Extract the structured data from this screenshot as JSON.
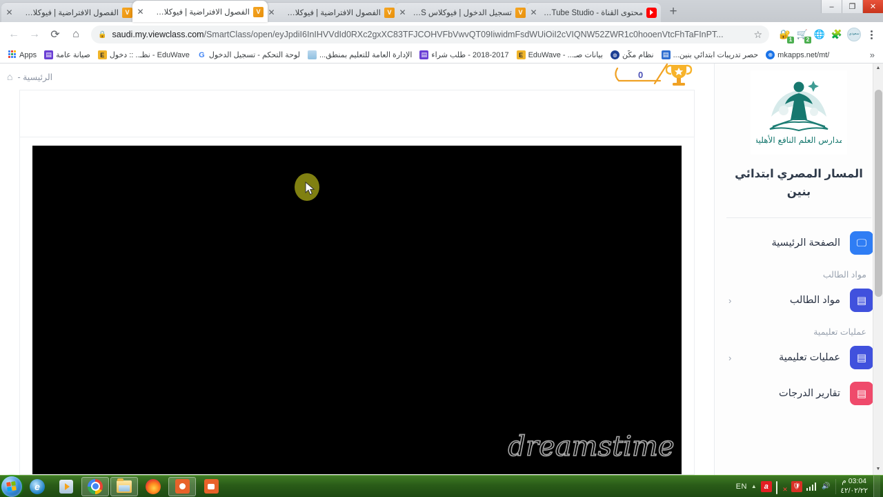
{
  "browser": {
    "tabs": [
      {
        "title": "الفصول الافتراضية | فيوكلاس LMS",
        "favicon": "viewclass-icon",
        "active": false
      },
      {
        "title": "الفصول الافتراضية | فيوكلاس LMS",
        "favicon": "viewclass-icon",
        "active": true
      },
      {
        "title": "الفصول الافتراضية | فيوكلاس LMS",
        "favicon": "viewclass-icon",
        "active": false
      },
      {
        "title": "تسجيل الدخول | فيوكلاس LMS",
        "favicon": "viewclass-icon",
        "active": false
      },
      {
        "title": "محتوى القناة - YouTube Studio",
        "favicon": "youtube-icon",
        "active": false
      }
    ],
    "new_tab_label": "+",
    "window_controls": {
      "minimize": "–",
      "maximize": "❐",
      "close": "✕"
    },
    "nav": {
      "back": "←",
      "forward": "→",
      "reload": "⟳",
      "home": "⌂"
    },
    "address": {
      "lock_icon": "lock-icon",
      "host": "saudi.my.viewclass.com",
      "path": "/SmartClass/open/eyJpdiI6InIHVVdId0RXc2gxXC83TFJCOHVFbVwvQT09IiwidmFsdWUiOiI2cVIQNW52ZWR1c0hooenVtcFhTaFInPT...",
      "bookmark_star": "☆"
    },
    "extensions": [
      {
        "name": "lastpass-icon",
        "glyph": "🔐",
        "badge": "1"
      },
      {
        "name": "shopping-cart-icon",
        "glyph": "🛒",
        "badge": "2"
      },
      {
        "name": "idm-globe-icon",
        "glyph": "🌐",
        "badge": ""
      },
      {
        "name": "puzzle-extensions-icon",
        "glyph": "🧩",
        "badge": ""
      },
      {
        "name": "profile-avatar-icon",
        "glyph": "سعودي",
        "badge": ""
      }
    ],
    "bookmarks": [
      {
        "label": "Apps",
        "icon": "apps-grid-icon"
      },
      {
        "label": "صيانة عامة",
        "icon": "purple-doc-icon"
      },
      {
        "label": "EduWave - نظـ.. :: دخول",
        "icon": "eduwave-icon"
      },
      {
        "label": "لوحة التحكم - تسجيل الدخول",
        "icon": "google-g-icon"
      },
      {
        "label": "الإدارة العامة للتعليم بمنطق...",
        "icon": "wave-icon"
      },
      {
        "label": "2018-2017 - طلب شراء",
        "icon": "purple-doc-icon"
      },
      {
        "label": "بيانات صـ... - EduWave",
        "icon": "eduwave-icon"
      },
      {
        "label": "نظام مكّن",
        "icon": "circle-icon"
      },
      {
        "label": "حصر تدريبات ابتدائي بنين...",
        "icon": "blue-doc-icon"
      },
      {
        "label": "mkapps.net/mt/",
        "icon": "globe-icon"
      }
    ],
    "bookmark_overflow": "»"
  },
  "page": {
    "breadcrumb": {
      "home_icon": "home-icon",
      "text": "الرئيسية -"
    },
    "score": {
      "value": "0",
      "icon": "trophy-icon"
    },
    "sidebar": {
      "logo_alt": "مدارس العلم النافع الأهلية",
      "logo_caption": "مدارس العلم النافع الأهلية",
      "title": "المسار المصري ابتدائي بنين",
      "items": [
        {
          "label": "الصفحة الرئيسية",
          "icon": "presentation-icon",
          "color": "#2f7df4",
          "chevron": ""
        },
        {
          "section": "مواد الطالب"
        },
        {
          "label": "مواد الطالب",
          "icon": "book-icon",
          "color": "#4051dd",
          "chevron": "‹"
        },
        {
          "section": "عمليات تعليمية"
        },
        {
          "label": "عمليات تعليمية",
          "icon": "book-icon",
          "color": "#4051dd",
          "chevron": "‹"
        },
        {
          "label": "تقارير الدرجات",
          "icon": "grades-icon",
          "color": "#ef4a6b",
          "chevron": ""
        }
      ]
    },
    "video": {
      "state": "black-screen",
      "cursor": "mouse-pointer"
    },
    "watermark": "dreamstime"
  },
  "taskbar": {
    "start": "start-orb",
    "apps": [
      {
        "name": "internet-explorer-icon",
        "open": false
      },
      {
        "name": "media-player-icon",
        "open": false
      },
      {
        "name": "google-chrome-icon",
        "open": true
      },
      {
        "name": "file-explorer-icon",
        "open": true
      },
      {
        "name": "firefox-icon",
        "open": false
      },
      {
        "name": "screen-capture-icon",
        "open": true
      },
      {
        "name": "camera-capture-icon",
        "open": false
      }
    ],
    "tray": {
      "language": "EN",
      "expand": "▲",
      "icons": [
        "avira-icon",
        "network-error-icon",
        "security-icon",
        "signal-bars-icon",
        "volume-icon"
      ],
      "time": "03:04 م",
      "date": "٤٢/٠٢/٢٢"
    }
  }
}
